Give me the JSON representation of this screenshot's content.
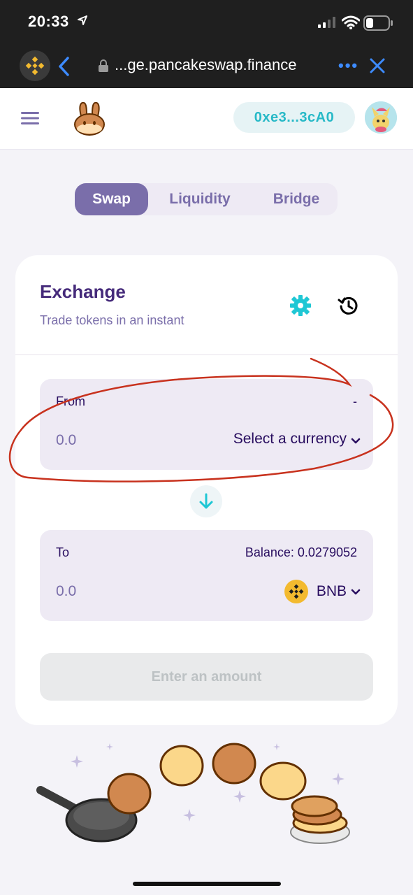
{
  "status_bar": {
    "time": "20:33"
  },
  "browser": {
    "url": "...ge.pancakeswap.finance",
    "more_label": "•••"
  },
  "header": {
    "wallet_address": "0xe3...3cA0"
  },
  "tabs": [
    {
      "label": "Swap",
      "active": true
    },
    {
      "label": "Liquidity",
      "active": false
    },
    {
      "label": "Bridge",
      "active": false
    }
  ],
  "exchange": {
    "title": "Exchange",
    "subtitle": "Trade tokens in an instant",
    "from": {
      "label": "From",
      "balance": "-",
      "amount_placeholder": "0.0",
      "currency_label": "Select a currency"
    },
    "to": {
      "label": "To",
      "balance": "Balance: 0.0279052",
      "amount_placeholder": "0.0",
      "currency_label": "BNB"
    },
    "submit_label": "Enter an amount"
  },
  "colors": {
    "accent": "#7a6eaa",
    "primary_text": "#280d5f",
    "title": "#452a7a",
    "teal": "#1fc7d4",
    "annotation_red": "#c8321e"
  }
}
